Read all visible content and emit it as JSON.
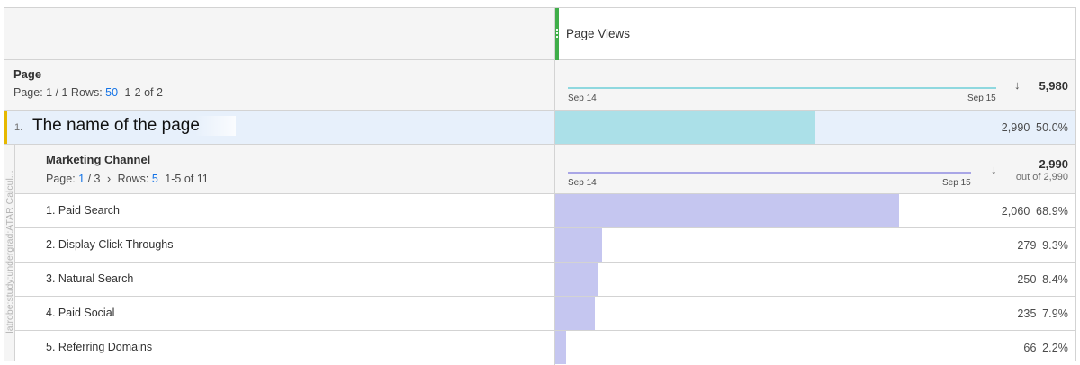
{
  "column": {
    "title": "Page Views",
    "accent": "#3fae49"
  },
  "page_dimension": {
    "title": "Page",
    "pager_prefix": "Page: 1 / 1 Rows:",
    "rows_value": "50",
    "range": "1-2 of 2",
    "spark_start": "Sep 14",
    "spark_end": "Sep 15",
    "total": "5,980"
  },
  "page_rows": [
    {
      "index": "1.",
      "name": "The name of the page",
      "value": "2,990",
      "percent": "50.0%",
      "fraction": 0.5
    }
  ],
  "breakdown": {
    "side_label": "latrobe:study:undergrad:ATAR Calcul...",
    "title": "Marketing Channel",
    "pager_page_label": "Page:",
    "pager_page": "1",
    "pager_of": "/ 3",
    "pager_next": "›",
    "rows_label": "Rows:",
    "rows_value": "5",
    "range": "1-5 of 11",
    "spark_start": "Sep 14",
    "spark_end": "Sep 15",
    "total": "2,990",
    "total_sub": "out of 2,990",
    "rows": [
      {
        "label": "1.  Paid Search",
        "value": "2,060",
        "percent": "68.9%",
        "fraction": 0.689
      },
      {
        "label": "2.  Display Click Throughs",
        "value": "279",
        "percent": "9.3%",
        "fraction": 0.093
      },
      {
        "label": "3.  Natural Search",
        "value": "250",
        "percent": "8.4%",
        "fraction": 0.084
      },
      {
        "label": "4.  Paid Social",
        "value": "235",
        "percent": "7.9%",
        "fraction": 0.079
      },
      {
        "label": "5.  Referring Domains",
        "value": "66",
        "percent": "2.2%",
        "fraction": 0.022
      }
    ]
  },
  "sort_arrow": "↓",
  "colors": {
    "page_bar": "#abe0e8",
    "breakdown_bar": "#c5c6f0",
    "spark_page": "#8fd8df",
    "spark_breakdown": "#a9a6e6",
    "row_marker": "#e6b800"
  }
}
